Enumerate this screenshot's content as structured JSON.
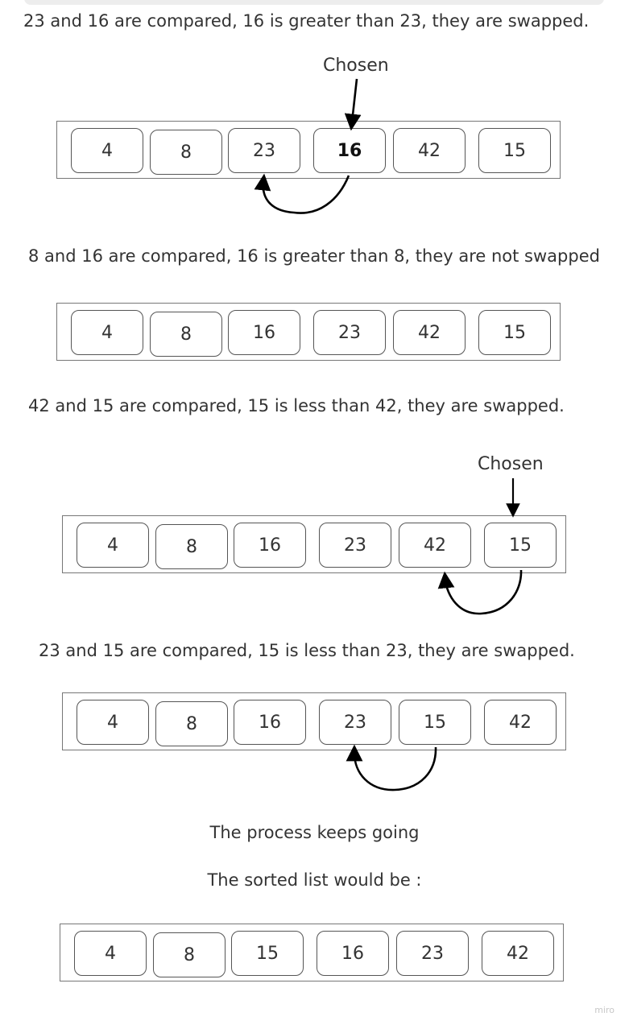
{
  "captions": {
    "step1": "23 and 16 are compared, 16 is greater than 23, they are swapped.",
    "step2": "8 and 16 are compared, 16 is greater than 8, they are not swapped",
    "step3": "42 and 15 are compared, 15 is less than 42, they are swapped.",
    "step4": "23 and 15 are compared, 15 is less than 23, they are swapped.",
    "process": "The process keeps going",
    "sorted": "The sorted list would be :"
  },
  "chosen_label": "Chosen",
  "arrays": {
    "a1": [
      "4",
      "8",
      "23",
      "16",
      "42",
      "15"
    ],
    "a2": [
      "4",
      "8",
      "16",
      "23",
      "42",
      "15"
    ],
    "a3": [
      "4",
      "8",
      "16",
      "23",
      "42",
      "15"
    ],
    "a4": [
      "4",
      "8",
      "16",
      "23",
      "15",
      "42"
    ],
    "a5": [
      "4",
      "8",
      "15",
      "16",
      "23",
      "42"
    ]
  },
  "watermark": "miro"
}
